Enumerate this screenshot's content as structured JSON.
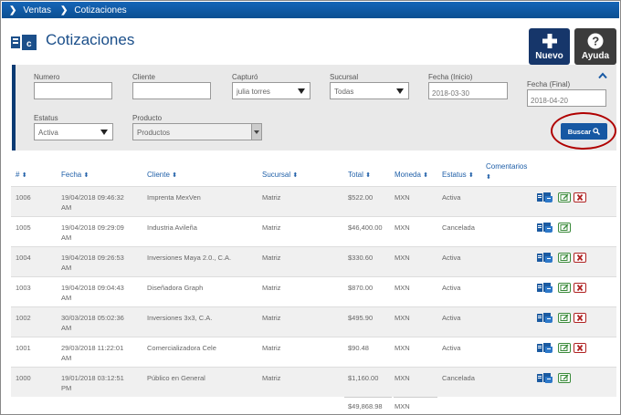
{
  "breadcrumb": {
    "items": [
      "Ventas",
      "Cotizaciones"
    ]
  },
  "page": {
    "title": "Cotizaciones"
  },
  "actions": {
    "nuevo_label": "Nuevo",
    "ayuda_label": "Ayuda"
  },
  "filters": {
    "numero": {
      "label": "Numero",
      "value": ""
    },
    "cliente": {
      "label": "Cliente",
      "value": ""
    },
    "capturo": {
      "label": "Capturó",
      "value": "julia torres"
    },
    "sucursal": {
      "label": "Sucursal",
      "value": "Todas"
    },
    "fecha_inicio": {
      "label": "Fecha (Inicio)",
      "value": "2018-03-30"
    },
    "fecha_final": {
      "label": "Fecha (Final)",
      "value": "2018-04-20"
    },
    "estatus": {
      "label": "Estatus",
      "value": "Activa"
    },
    "producto": {
      "label": "Producto",
      "placeholder": "Productos"
    },
    "buscar_label": "Buscar"
  },
  "table": {
    "headers": [
      "#",
      "Fecha",
      "Cliente",
      "Sucursal",
      "Total",
      "Moneda",
      "Estatus",
      "Comentarios"
    ],
    "rows": [
      {
        "num": "1006",
        "fecha1": "19/04/2018 09:46:32",
        "fecha2": "AM",
        "cliente": "Imprenta MexVen",
        "sucursal": "Matriz",
        "total": "$522.00",
        "moneda": "MXN",
        "estatus": "Activa",
        "can_delete": true
      },
      {
        "num": "1005",
        "fecha1": "19/04/2018 09:29:09",
        "fecha2": "AM",
        "cliente": "Industria Avileña",
        "sucursal": "Matriz",
        "total": "$46,400.00",
        "moneda": "MXN",
        "estatus": "Cancelada",
        "can_delete": false
      },
      {
        "num": "1004",
        "fecha1": "19/04/2018 09:26:53",
        "fecha2": "AM",
        "cliente": "Inversiones Maya 2.0., C.A.",
        "sucursal": "Matriz",
        "total": "$330.60",
        "moneda": "MXN",
        "estatus": "Activa",
        "can_delete": true
      },
      {
        "num": "1003",
        "fecha1": "19/04/2018 09:04:43",
        "fecha2": "AM",
        "cliente": "Diseñadora Graph",
        "sucursal": "Matriz",
        "total": "$870.00",
        "moneda": "MXN",
        "estatus": "Activa",
        "can_delete": true
      },
      {
        "num": "1002",
        "fecha1": "30/03/2018 05:02:36",
        "fecha2": "AM",
        "cliente": "Inversiones 3x3, C.A.",
        "sucursal": "Matriz",
        "total": "$495.90",
        "moneda": "MXN",
        "estatus": "Activa",
        "can_delete": true
      },
      {
        "num": "1001",
        "fecha1": "29/03/2018 11:22:01",
        "fecha2": "AM",
        "cliente": "Comercializadora Cele",
        "sucursal": "Matriz",
        "total": "$90.48",
        "moneda": "MXN",
        "estatus": "Activa",
        "can_delete": true
      },
      {
        "num": "1000",
        "fecha1": "19/01/2018 03:12:51",
        "fecha2": "PM",
        "cliente": "Público en General",
        "sucursal": "Matriz",
        "total": "$1,160.00",
        "moneda": "MXN",
        "estatus": "Cancelada",
        "can_delete": false
      }
    ],
    "footer": {
      "total": "$49,868.98",
      "moneda": "MXN"
    }
  },
  "colors": {
    "accent": "#1658a3",
    "header_bar": "#0b4f92",
    "title": "#1b4f8a",
    "link": "#1f5fa8",
    "danger": "#b02222",
    "success": "#3a8a3a"
  },
  "icons": {
    "breadcrumb_sep": "chevron-right-icon",
    "title": "quote-document-icon",
    "nuevo": "plus-icon",
    "ayuda": "question-icon",
    "buscar": "search-icon",
    "collapse": "chevron-up-icon",
    "row_copy": "copy-document-icon",
    "row_edit": "edit-icon",
    "row_delete": "close-icon"
  }
}
